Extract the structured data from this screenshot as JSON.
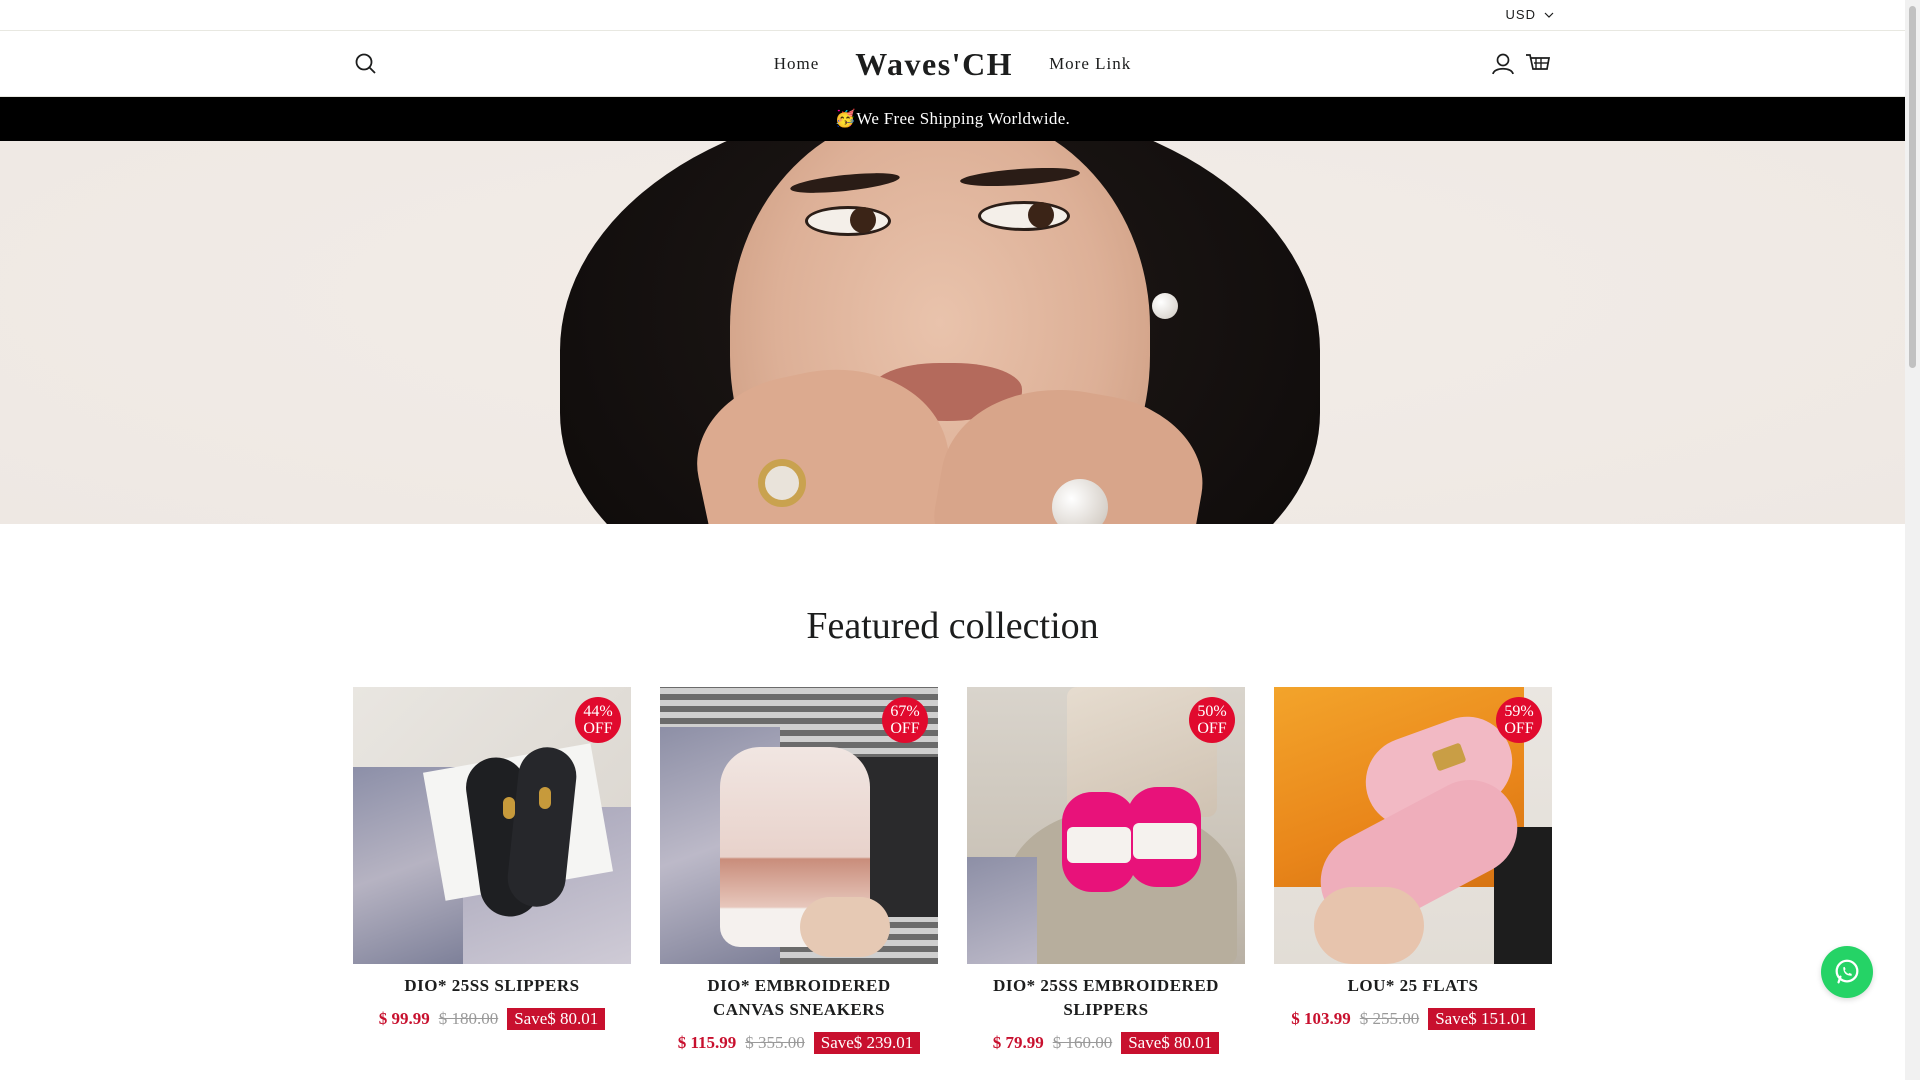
{
  "utility": {
    "currency": "USD"
  },
  "header": {
    "logo": "Waves'CH",
    "nav": {
      "home": "Home",
      "more": "More Link"
    }
  },
  "announcement": {
    "text": "🥳We Free Shipping Worldwide."
  },
  "featured": {
    "title": "Featured collection",
    "products": [
      {
        "badge_pct": "44%",
        "badge_off": "OFF",
        "title": "DIO* 25SS SLIPPERS",
        "price": "$ 99.99",
        "compare": "$ 180.00",
        "save": "Save$ 80.01"
      },
      {
        "badge_pct": "67%",
        "badge_off": "OFF",
        "title": "DIO* EMBROIDERED CANVAS SNEAKERS",
        "price": "$ 115.99",
        "compare": "$ 355.00",
        "save": "Save$ 239.01"
      },
      {
        "badge_pct": "50%",
        "badge_off": "OFF",
        "title": "DIO* 25SS EMBROIDERED SLIPPERS",
        "price": "$ 79.99",
        "compare": "$ 160.00",
        "save": "Save$ 80.01"
      },
      {
        "badge_pct": "59%",
        "badge_off": "OFF",
        "title": "LOU* 25 FLATS",
        "price": "$ 103.99",
        "compare": "$ 255.00",
        "save": "Save$ 151.01"
      }
    ]
  },
  "colors": {
    "accent": "#c8102e",
    "badge": "#e10a2e",
    "whatsapp": "#25d366",
    "announcement_bg": "#000000"
  },
  "icons": [
    "search-icon",
    "user-icon",
    "cart-icon",
    "chevron-down-icon",
    "whatsapp-icon"
  ]
}
